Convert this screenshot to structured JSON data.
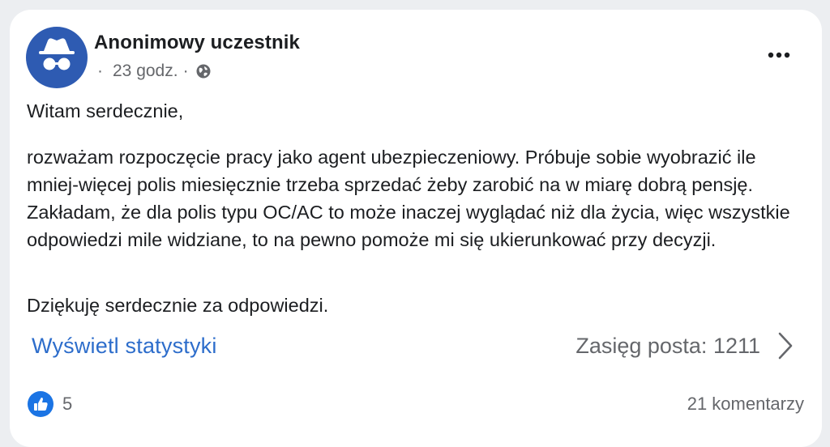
{
  "post": {
    "author": "Anonimowy uczestnik",
    "separator": "·",
    "time": "23 godz.",
    "greeting": "Witam serdecznie,",
    "body": "rozważam rozpoczęcie pracy jako agent ubezpieczeniowy. Próbuje sobie wyobrazić ile mniej-więcej polis miesięcznie trzeba sprzedać żeby zarobić na w miarę dobrą pensję. Zakładam, że dla polis typu OC/AC to może inaczej wyglądać niż dla życia, więc wszystkie odpowiedzi mile widziane, to na pewno pomoże mi się ukierunkować przy decyzji.",
    "closing": "Dziękuję serdecznie za odpowiedzi.",
    "stats_link": "Wyświetl statystyki",
    "reach": "Zasięg posta: 1211",
    "likes": "5",
    "comments": "21 komentarzy"
  },
  "icons": {
    "avatar": "anonymous-incognito-icon",
    "privacy": "globe-icon",
    "more": "more-dots-icon",
    "chevron": "chevron-right-icon",
    "like": "like-thumb-icon"
  },
  "colors": {
    "avatar_bg": "#2e5bb2",
    "link": "#2d6dcb",
    "like": "#1b74e4",
    "secondary_text": "#65676b"
  }
}
